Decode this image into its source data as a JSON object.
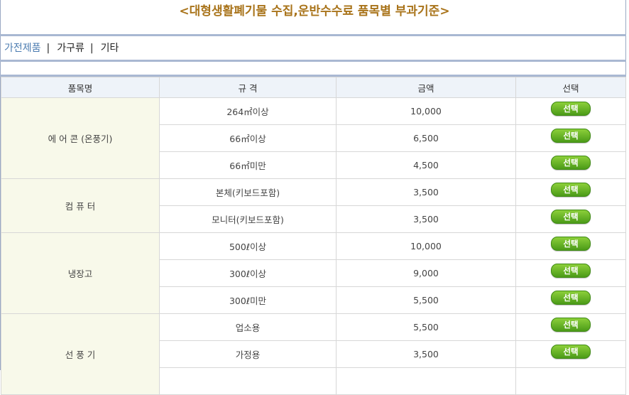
{
  "page": {
    "title": "<대형생활폐기물 수집,운반수수료 품목별 부과기준>"
  },
  "tabs": [
    {
      "label": "가전제품",
      "active": true
    },
    {
      "label": "가구류",
      "active": false
    },
    {
      "label": "기타",
      "active": false
    }
  ],
  "tab_separator": "|",
  "table": {
    "headers": [
      "품목명",
      "규 격",
      "금액",
      "선택"
    ],
    "button_label": "선택",
    "groups": [
      {
        "name": "에 어 콘 (온풍기)",
        "rows": [
          {
            "spec": "264㎡이상",
            "amount": "10,000"
          },
          {
            "spec": "66㎡이상",
            "amount": "6,500"
          },
          {
            "spec": "66㎡미만",
            "amount": "4,500"
          }
        ]
      },
      {
        "name": "컴 퓨 터",
        "rows": [
          {
            "spec": "본체(키보드포함)",
            "amount": "3,500"
          },
          {
            "spec": "모니터(키보드포함)",
            "amount": "3,500"
          }
        ]
      },
      {
        "name": "냉장고",
        "rows": [
          {
            "spec": "500ℓ이상",
            "amount": "10,000"
          },
          {
            "spec": "300ℓ이상",
            "amount": "9,000"
          },
          {
            "spec": "300ℓ미만",
            "amount": "5,500"
          }
        ]
      },
      {
        "name": "선 풍 기",
        "rows": [
          {
            "spec": "업소용",
            "amount": "5,500"
          },
          {
            "spec": "가정용",
            "amount": "3,500"
          },
          {
            "spec": "",
            "amount": ""
          }
        ]
      }
    ]
  },
  "colors": {
    "title": "#a9741b",
    "active_tab": "#4c7cb1",
    "header_bg": "#eef3f9",
    "category_bg": "#f8f9ea",
    "button": "#5aad22",
    "rule": "#a9b8d2"
  }
}
